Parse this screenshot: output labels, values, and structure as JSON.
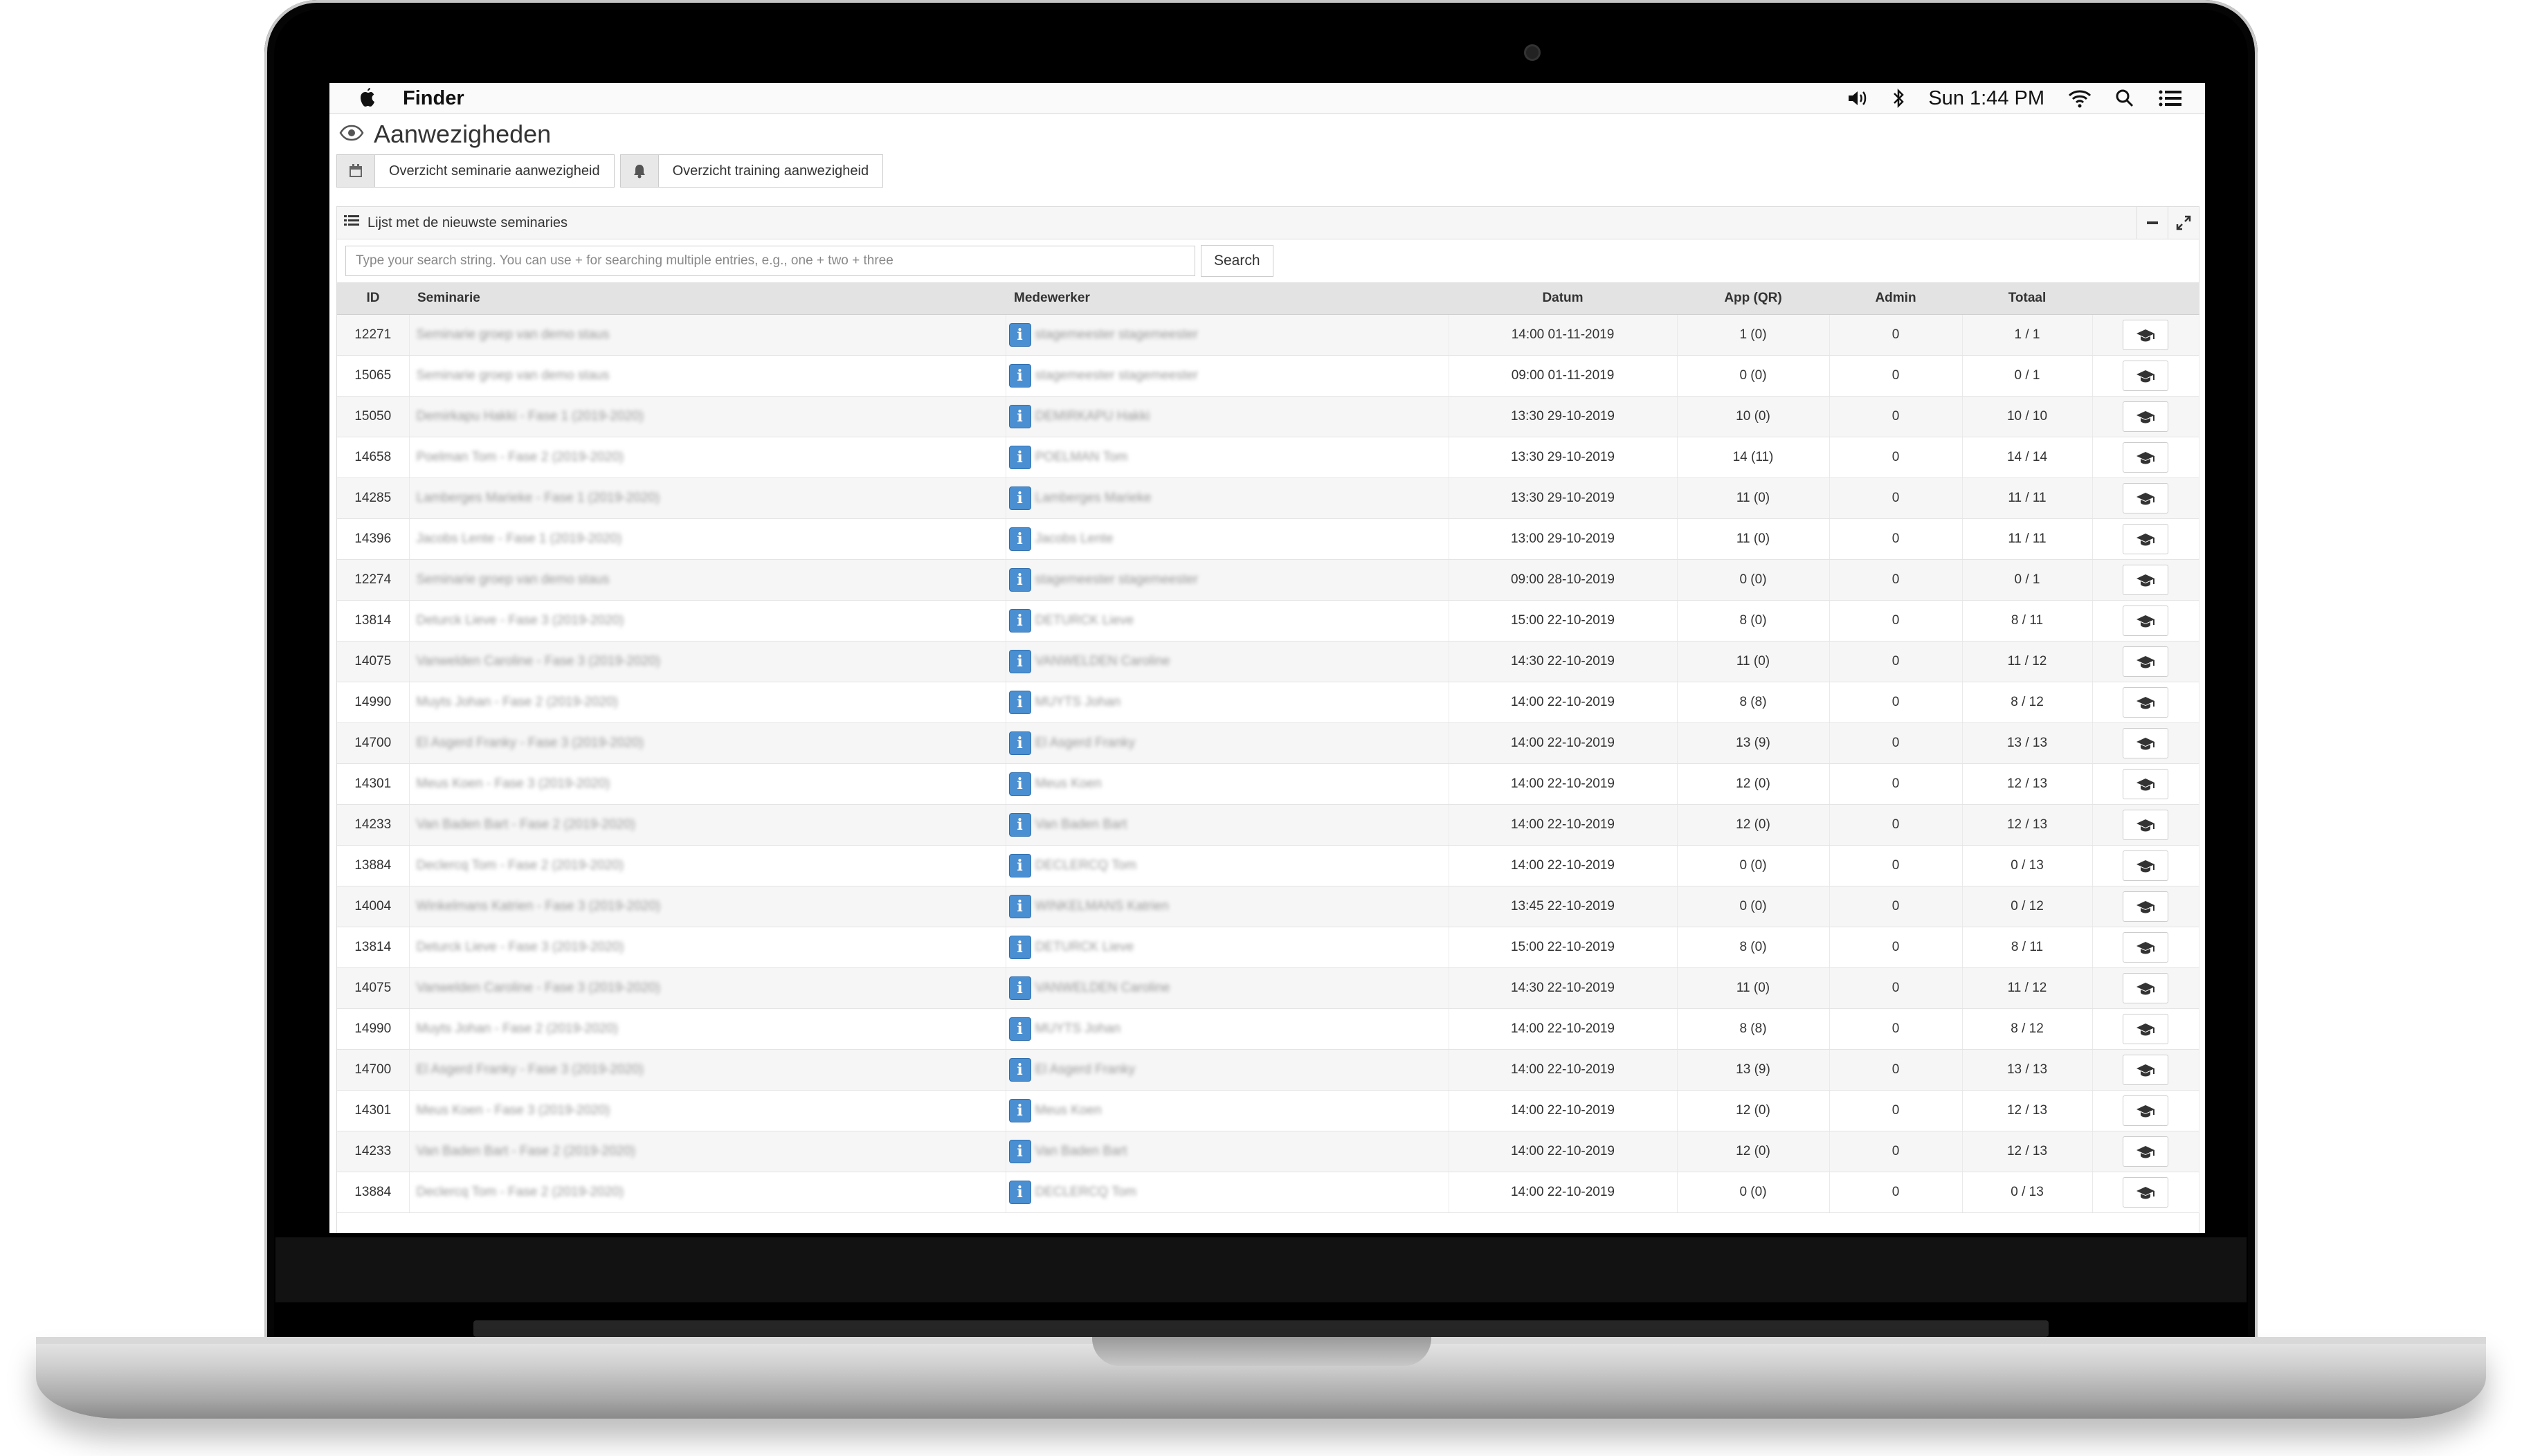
{
  "menubar": {
    "app_name": "Finder",
    "clock": "Sun 1:44 PM",
    "icons": [
      "apple-icon",
      "volume-icon",
      "bluetooth-icon",
      "wifi-icon",
      "search-icon",
      "list-icon"
    ]
  },
  "page": {
    "title": "Aanwezigheden",
    "title_icon": "eye-icon"
  },
  "tabs": [
    {
      "label": "Overzicht seminarie aanwezigheid",
      "icon": "calendar-icon"
    },
    {
      "label": "Overzicht training aanwezigheid",
      "icon": "bell-icon"
    }
  ],
  "panel": {
    "title": "Lijst met de nieuwste seminaries",
    "title_icon": "list-icon",
    "buttons": [
      "minimize-icon",
      "expand-icon"
    ]
  },
  "search": {
    "placeholder": "Type your search string. You can use + for searching multiple entries, e.g., one + two + three",
    "button_label": "Search"
  },
  "table": {
    "headers": {
      "id": "ID",
      "seminarie": "Seminarie",
      "medewerker": "Medewerker",
      "datum": "Datum",
      "app": "App (QR)",
      "admin": "Admin",
      "totaal": "Totaal"
    },
    "rows": [
      {
        "id": "12271",
        "seminarie": "Seminarie groep van demo staus",
        "medewerker": "stagemeester stagemeester",
        "datum": "14:00 01-11-2019",
        "app": "1 (0)",
        "admin": "0",
        "totaal": "1 / 1"
      },
      {
        "id": "15065",
        "seminarie": "Seminarie groep van demo staus",
        "medewerker": "stagemeester stagemeester",
        "datum": "09:00 01-11-2019",
        "app": "0 (0)",
        "admin": "0",
        "totaal": "0 / 1"
      },
      {
        "id": "15050",
        "seminarie": "Demirkapu Hakki - Fase 1 (2019-2020)",
        "medewerker": "DEMIRKAPU Hakki",
        "datum": "13:30 29-10-2019",
        "app": "10 (0)",
        "admin": "0",
        "totaal": "10 / 10"
      },
      {
        "id": "14658",
        "seminarie": "Poelman Tom - Fase 2 (2019-2020)",
        "medewerker": "POELMAN Tom",
        "datum": "13:30 29-10-2019",
        "app": "14 (11)",
        "admin": "0",
        "totaal": "14 / 14"
      },
      {
        "id": "14285",
        "seminarie": "Lamberges Marieke - Fase 1 (2019-2020)",
        "medewerker": "Lamberges Marieke",
        "datum": "13:30 29-10-2019",
        "app": "11 (0)",
        "admin": "0",
        "totaal": "11 / 11"
      },
      {
        "id": "14396",
        "seminarie": "Jacobs Lente - Fase 1 (2019-2020)",
        "medewerker": "Jacobs Lente",
        "datum": "13:00 29-10-2019",
        "app": "11 (0)",
        "admin": "0",
        "totaal": "11 / 11"
      },
      {
        "id": "12274",
        "seminarie": "Seminarie groep van demo staus",
        "medewerker": "stagemeester stagemeester",
        "datum": "09:00 28-10-2019",
        "app": "0 (0)",
        "admin": "0",
        "totaal": "0 / 1"
      },
      {
        "id": "13814",
        "seminarie": "Deturck Lieve - Fase 3 (2019-2020)",
        "medewerker": "DETURCK Lieve",
        "datum": "15:00 22-10-2019",
        "app": "8 (0)",
        "admin": "0",
        "totaal": "8 / 11"
      },
      {
        "id": "14075",
        "seminarie": "Vanwelden Caroline - Fase 3 (2019-2020)",
        "medewerker": "VANWELDEN Caroline",
        "datum": "14:30 22-10-2019",
        "app": "11 (0)",
        "admin": "0",
        "totaal": "11 / 12"
      },
      {
        "id": "14990",
        "seminarie": "Muyts Johan - Fase 2 (2019-2020)",
        "medewerker": "MUYTS Johan",
        "datum": "14:00 22-10-2019",
        "app": "8 (8)",
        "admin": "0",
        "totaal": "8 / 12"
      },
      {
        "id": "14700",
        "seminarie": "El Asgerd Franky - Fase 3 (2019-2020)",
        "medewerker": "El Asgerd Franky",
        "datum": "14:00 22-10-2019",
        "app": "13 (9)",
        "admin": "0",
        "totaal": "13 / 13"
      },
      {
        "id": "14301",
        "seminarie": "Meus Koen - Fase 3 (2019-2020)",
        "medewerker": "Meus Koen",
        "datum": "14:00 22-10-2019",
        "app": "12 (0)",
        "admin": "0",
        "totaal": "12 / 13"
      },
      {
        "id": "14233",
        "seminarie": "Van Baden Bart - Fase 2 (2019-2020)",
        "medewerker": "Van Baden Bart",
        "datum": "14:00 22-10-2019",
        "app": "12 (0)",
        "admin": "0",
        "totaal": "12 / 13"
      },
      {
        "id": "13884",
        "seminarie": "Declercq Tom - Fase 2 (2019-2020)",
        "medewerker": "DECLERCQ Tom",
        "datum": "14:00 22-10-2019",
        "app": "0 (0)",
        "admin": "0",
        "totaal": "0 / 13"
      },
      {
        "id": "14004",
        "seminarie": "Winkelmans Katrien - Fase 3 (2019-2020)",
        "medewerker": "WINKELMANS Katrien",
        "datum": "13:45 22-10-2019",
        "app": "0 (0)",
        "admin": "0",
        "totaal": "0 / 12"
      },
      {
        "id": "13814",
        "seminarie": "Deturck Lieve - Fase 3 (2019-2020)",
        "medewerker": "DETURCK Lieve",
        "datum": "15:00 22-10-2019",
        "app": "8 (0)",
        "admin": "0",
        "totaal": "8 / 11"
      },
      {
        "id": "14075",
        "seminarie": "Vanwelden Caroline - Fase 3 (2019-2020)",
        "medewerker": "VANWELDEN Caroline",
        "datum": "14:30 22-10-2019",
        "app": "11 (0)",
        "admin": "0",
        "totaal": "11 / 12"
      },
      {
        "id": "14990",
        "seminarie": "Muyts Johan - Fase 2 (2019-2020)",
        "medewerker": "MUYTS Johan",
        "datum": "14:00 22-10-2019",
        "app": "8 (8)",
        "admin": "0",
        "totaal": "8 / 12"
      },
      {
        "id": "14700",
        "seminarie": "El Asgerd Franky - Fase 3 (2019-2020)",
        "medewerker": "El Asgerd Franky",
        "datum": "14:00 22-10-2019",
        "app": "13 (9)",
        "admin": "0",
        "totaal": "13 / 13"
      },
      {
        "id": "14301",
        "seminarie": "Meus Koen - Fase 3 (2019-2020)",
        "medewerker": "Meus Koen",
        "datum": "14:00 22-10-2019",
        "app": "12 (0)",
        "admin": "0",
        "totaal": "12 / 13"
      },
      {
        "id": "14233",
        "seminarie": "Van Baden Bart - Fase 2 (2019-2020)",
        "medewerker": "Van Baden Bart",
        "datum": "14:00 22-10-2019",
        "app": "12 (0)",
        "admin": "0",
        "totaal": "12 / 13"
      },
      {
        "id": "13884",
        "seminarie": "Declercq Tom - Fase 2 (2019-2020)",
        "medewerker": "DECLERCQ Tom",
        "datum": "14:00 22-10-2019",
        "app": "0 (0)",
        "admin": "0",
        "totaal": "0 / 13"
      }
    ]
  },
  "colors": {
    "info_icon": "#4a8fd2",
    "header_bg": "#e3e3e3",
    "row_alt": "#f6f6f6"
  }
}
